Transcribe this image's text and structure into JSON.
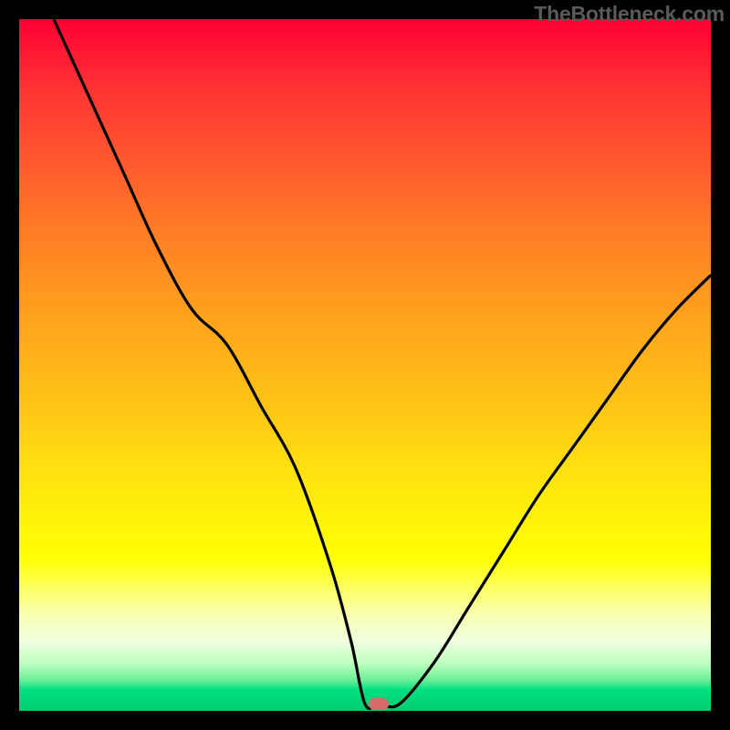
{
  "branding": "TheBottleneck.com",
  "chart_data": {
    "type": "line",
    "title": "",
    "xlabel": "",
    "ylabel": "",
    "xlim": [
      0,
      100
    ],
    "ylim": [
      0,
      100
    ],
    "grid": false,
    "series": [
      {
        "name": "curve",
        "x": [
          5,
          10,
          15,
          20,
          25,
          30,
          35,
          40,
          45,
          48,
          50,
          52,
          55,
          60,
          65,
          70,
          75,
          80,
          85,
          90,
          95,
          100
        ],
        "values": [
          100,
          89,
          78,
          67,
          58,
          53,
          44,
          35,
          21,
          10,
          1,
          1,
          1,
          7,
          15,
          23,
          31,
          38,
          45,
          52,
          58,
          63
        ]
      }
    ],
    "marker": {
      "x": 52,
      "y": 1,
      "color": "#d96a6a"
    },
    "background_gradient": {
      "top": "#ff0033",
      "middle": "#ffff00",
      "bottom": "#00cc70"
    }
  }
}
